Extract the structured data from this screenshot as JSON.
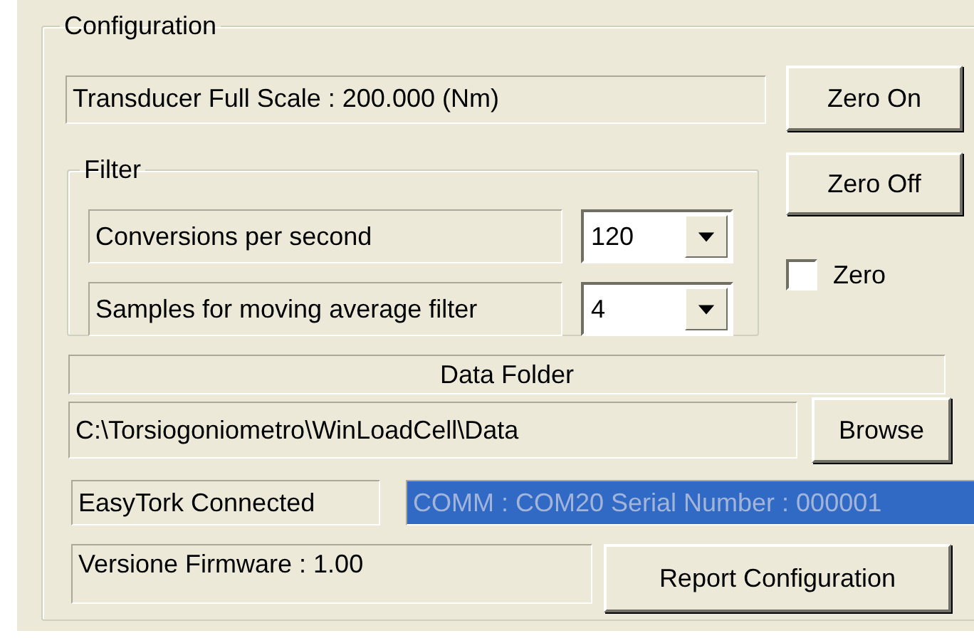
{
  "configuration": {
    "title": "Configuration",
    "full_scale_label": "Transducer Full Scale : 200.000 (Nm)",
    "zero_on_button": "Zero On",
    "zero_off_button": "Zero Off",
    "filter": {
      "title": "Filter",
      "rows": [
        {
          "label": "Conversions per second",
          "value": "120"
        },
        {
          "label": "Samples for moving average filter",
          "value": "4"
        }
      ]
    },
    "zero_checkbox": {
      "label": "Zero",
      "checked": false
    },
    "data_folder": {
      "title": "Data Folder",
      "path": "C:\\Torsiogoniometro\\WinLoadCell\\Data",
      "browse_button": "Browse"
    },
    "connection": {
      "status": "EasyTork Connected",
      "port": {
        "text": "COMM : COM20 Serial Number : 000001",
        "selected": true
      }
    },
    "firmware": "Versione Firmware : 1.00",
    "report_button": "Report Configuration"
  }
}
